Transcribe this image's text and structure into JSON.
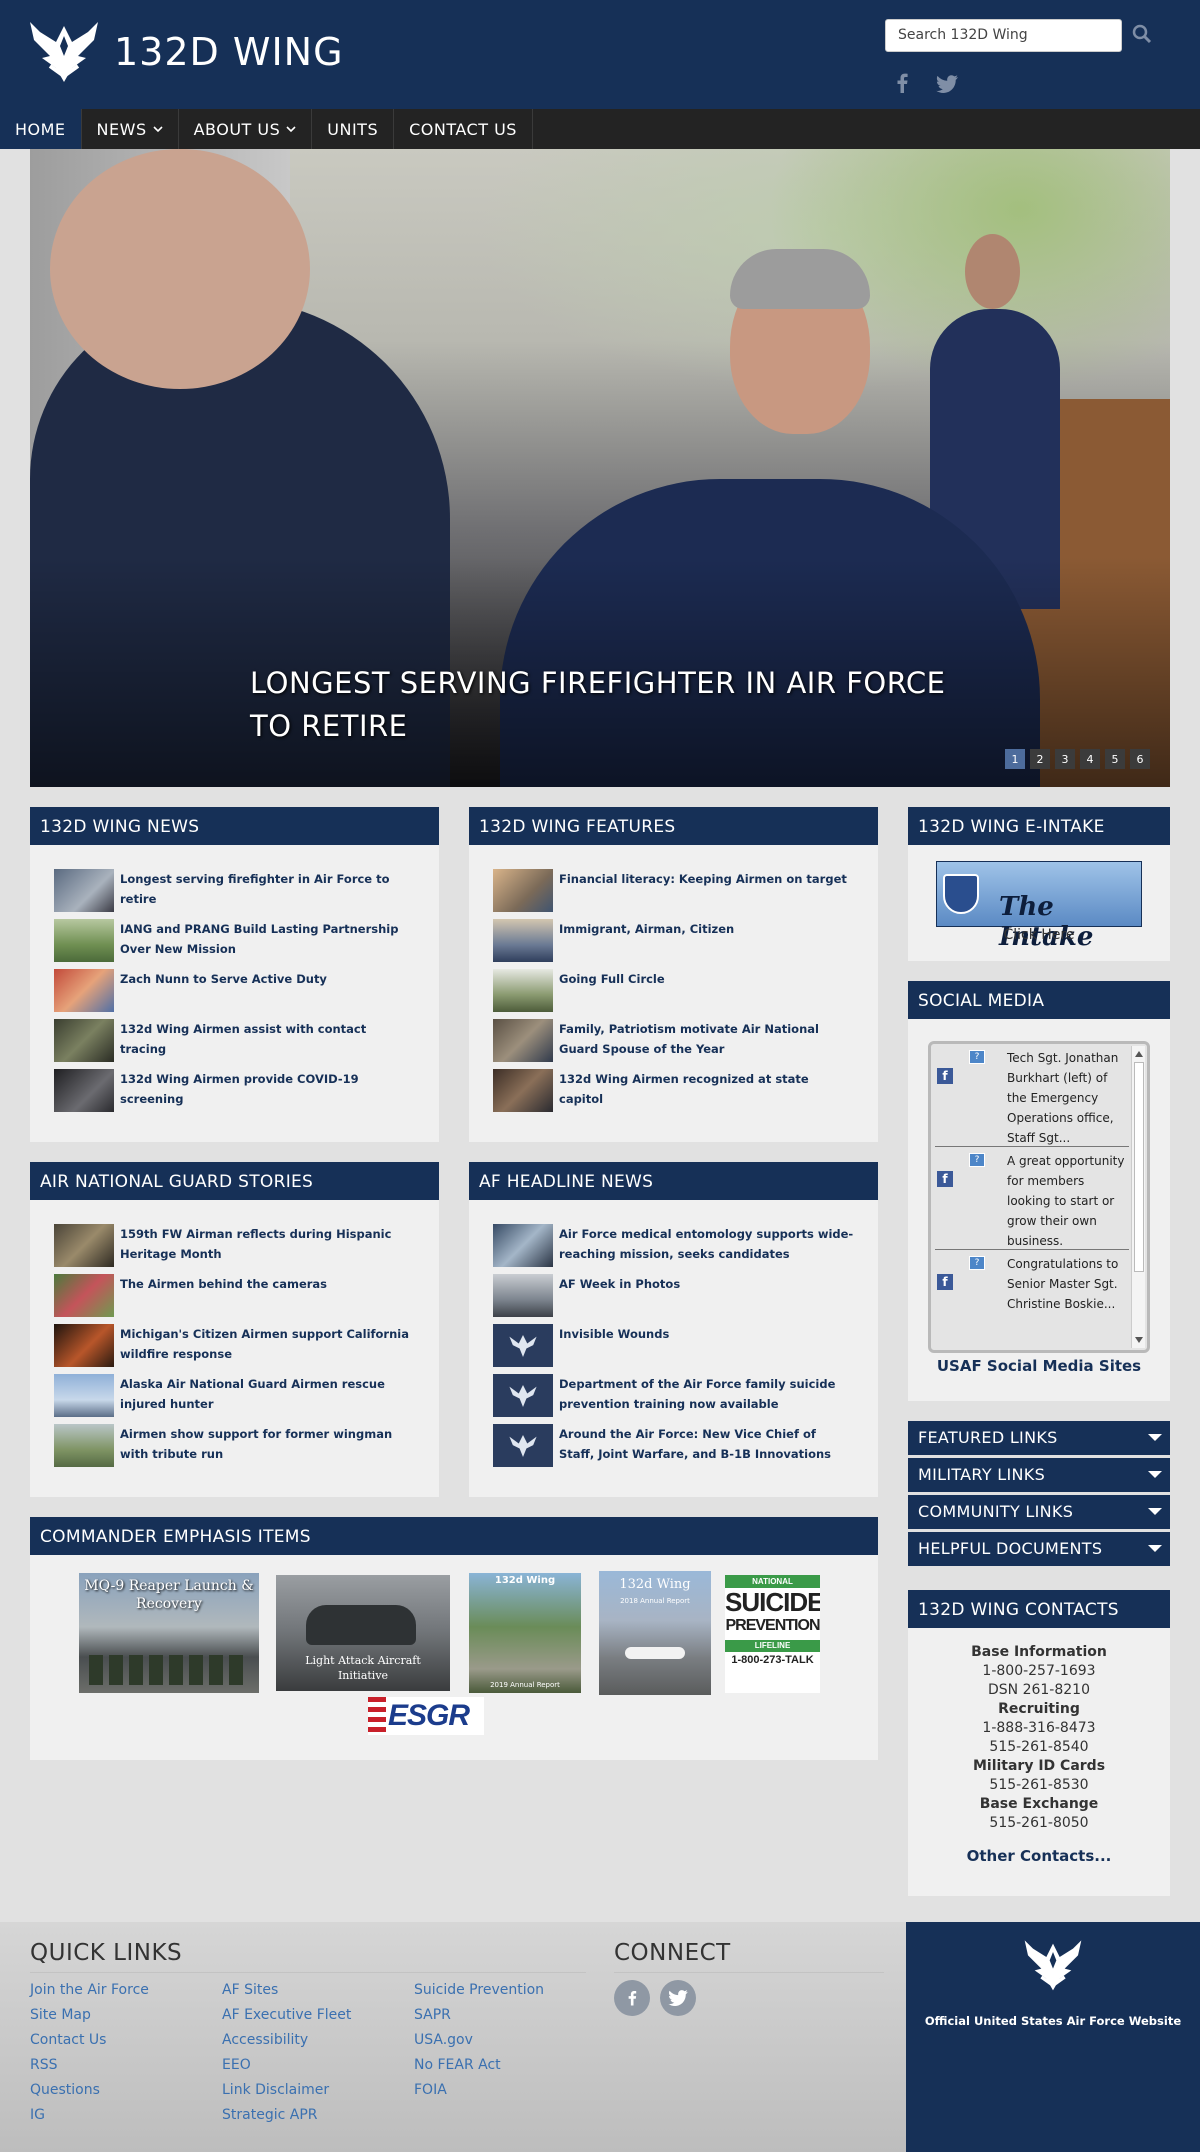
{
  "header": {
    "title": "132D WING",
    "search_placeholder": "Search 132D Wing"
  },
  "nav": {
    "items": [
      {
        "label": "HOME"
      },
      {
        "label": "NEWS"
      },
      {
        "label": "ABOUT US"
      },
      {
        "label": "UNITS"
      },
      {
        "label": "CONTACT US"
      }
    ]
  },
  "hero": {
    "caption": "LONGEST SERVING FIREFIGHTER IN AIR FORCE TO RETIRE",
    "slides": [
      "1",
      "2",
      "3",
      "4",
      "5",
      "6"
    ],
    "active_slide": "1"
  },
  "wing_news": {
    "title": "132D WING NEWS",
    "items": [
      "Longest serving firefighter in Air Force to retire",
      "IANG and PRANG Build Lasting Partnership Over New Mission",
      "Zach Nunn to Serve Active Duty",
      "132d Wing Airmen assist with contact tracing",
      "132d Wing Airmen provide COVID-19 screening"
    ]
  },
  "wing_features": {
    "title": "132D WING FEATURES",
    "items": [
      "Financial literacy: Keeping Airmen on target",
      "Immigrant, Airman, Citizen",
      "Going Full Circle",
      "Family, Patriotism motivate Air National Guard Spouse of the Year",
      "132d Wing Airmen recognized at state capitol"
    ]
  },
  "ang_stories": {
    "title": "AIR NATIONAL GUARD STORIES",
    "items": [
      "159th FW Airman reflects during Hispanic Heritage Month",
      "The Airmen behind the cameras",
      "Michigan's Citizen Airmen support California wildfire response",
      "Alaska Air National Guard Airmen rescue injured hunter",
      "Airmen show support for former wingman with tribute run"
    ]
  },
  "af_headlines": {
    "title": "AF HEADLINE NEWS",
    "items": [
      "Air Force medical entomology supports wide-reaching mission, seeks candidates",
      "AF Week in Photos",
      "Invisible Wounds",
      "Department of the Air Force family suicide prevention training now available",
      "Around the Air Force: New Vice Chief of Staff, Joint Warfare, and B-1B Innovations"
    ]
  },
  "emphasis": {
    "title": "COMMANDER EMPHASIS ITEMS",
    "items": [
      {
        "title": "MQ-9 Reaper Launch & Recovery"
      },
      {
        "title": "Light Attack Aircraft Initiative"
      },
      {
        "title": "132d Wing",
        "subtitle": "2019 Annual Report"
      },
      {
        "title": "132d Wing",
        "subtitle": "2018 Annual Report"
      },
      {
        "line1": "NATIONAL",
        "line2": "SUICIDE",
        "line3": "PREVENTION",
        "line4": "LIFELINE",
        "line5": "1-800-273-TALK"
      },
      {
        "title": "ESGR"
      }
    ]
  },
  "e_intake": {
    "title": "132D WING E-INTAKE",
    "image_text": "The Intake",
    "link": "Click Here"
  },
  "social": {
    "title": "SOCIAL MEDIA",
    "posts": [
      "Tech Sgt. Jonathan Burkhart (left) of the Emergency Operations office, Staff Sgt...",
      "A great opportunity for members looking to start or grow their own business.",
      "Congratulations to Senior Master Sgt. Christine Boskie..."
    ],
    "link": "USAF Social Media Sites"
  },
  "accordions": [
    "FEATURED LINKS",
    "MILITARY LINKS",
    "COMMUNITY LINKS",
    "HELPFUL DOCUMENTS"
  ],
  "contacts": {
    "title": "132D WING CONTACTS",
    "base_info_label": "Base Information",
    "base_info_1": "1-800-257-1693",
    "base_info_2": "DSN 261-8210",
    "recruiting_label": "Recruiting",
    "recruiting_1": "1-888-316-8473",
    "recruiting_2": "515-261-8540",
    "id_label": "Military ID Cards",
    "id_1": "515-261-8530",
    "bx_label": "Base Exchange",
    "bx_1": "515-261-8050",
    "other": "Other Contacts..."
  },
  "footer": {
    "quick_links_title": "QUICK LINKS",
    "connect_title": "CONNECT",
    "col1": [
      "Join the Air Force",
      "Site Map",
      "Contact Us",
      "RSS",
      "Questions",
      "IG"
    ],
    "col2": [
      "AF Sites",
      "AF Executive Fleet",
      "Accessibility",
      "EEO",
      "Link Disclaimer",
      "Strategic APR"
    ],
    "col3": [
      "Suicide Prevention",
      "SAPR",
      "USA.gov",
      "No FEAR Act",
      "FOIA"
    ],
    "official": "Official United States Air Force Website"
  },
  "colors": {
    "brand_navy": "#163057",
    "nav_dark": "#232323",
    "link_blue": "#3a70b0"
  }
}
